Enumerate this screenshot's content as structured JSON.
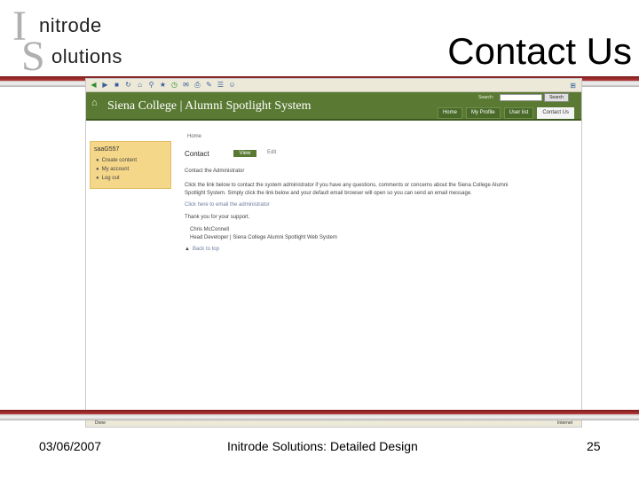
{
  "logo": {
    "initial1": "I",
    "word1": "nitrode",
    "initial2": "S",
    "word2": "olutions"
  },
  "slide_title": "Contact Us",
  "browser": {
    "toolbar_icons": [
      "back-icon",
      "forward-icon",
      "stop-icon",
      "refresh-icon",
      "home-icon",
      "search-icon",
      "favorites-icon",
      "history-icon",
      "mail-icon",
      "print-icon",
      "edit-icon",
      "discuss-icon",
      "messenger-icon"
    ],
    "site": {
      "title": "Siena College | Alumni Spotlight System",
      "search_label": "Search:",
      "search_button": "Search",
      "nav": [
        "Home",
        "My Profile",
        "User list",
        "Contact Us"
      ],
      "active_nav": "Contact Us"
    },
    "sidebar": {
      "user": "saaG557",
      "items": [
        "Create content",
        "My account",
        "Log out"
      ]
    },
    "content": {
      "home_link": "Home",
      "title": "Contact",
      "tab_view": "View",
      "tab_edit": "Edit",
      "heading": "Contact the Administrator",
      "para1": "Click the link below to contact the system administrator if you have any questions, comments or concerns about the Siena College Alumni",
      "para2": "Spotlight System. Simply click the link below and your default email browser will open so you can send an email message.",
      "link": "Click here to email the administrator",
      "thanks": "Thank you for your support.",
      "sig_name": "Chris McConnell",
      "sig_role": "Head Developer | Siena College Alumni Spotlight Web System",
      "back_to_top": "Back to top"
    },
    "status": {
      "left": "Done",
      "right": "Internet"
    }
  },
  "footer": {
    "date": "03/06/2007",
    "center": "Initrode Solutions: Detailed Design",
    "page": "25"
  }
}
